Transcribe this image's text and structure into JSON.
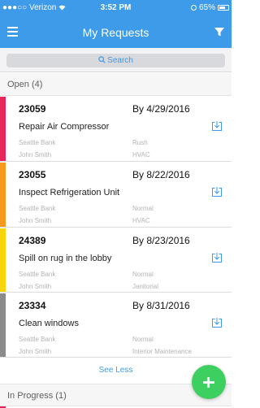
{
  "status_bar": {
    "carrier": "●●●○○ Verizon",
    "time": "3:52 PM",
    "battery": "65%"
  },
  "nav": {
    "title": "My Requests",
    "menu_icon": "hamburger-icon",
    "filter_icon": "filter-icon"
  },
  "search": {
    "placeholder": "Search",
    "icon": "search-icon"
  },
  "sections": {
    "open": "Open (4)",
    "in_progress": "In Progress (1)"
  },
  "requests": [
    {
      "id": "23059",
      "due": "By 4/29/2016",
      "title": "Repair Air Compressor",
      "location": "Seattle Bank",
      "priority": "Rush",
      "assignee": "John Smith",
      "category": "HVAC",
      "color": "#e8265a"
    },
    {
      "id": "23055",
      "due": "By 8/22/2016",
      "title": "Inspect Refrigeration Unit",
      "location": "Seattle Bank",
      "priority": "Normal",
      "assignee": "John Smith",
      "category": "HVAC",
      "color": "#f59a1c"
    },
    {
      "id": "24389",
      "due": "By 8/23/2016",
      "title": "Spill on rug in the lobby",
      "location": "Seattle Bank",
      "priority": "Normal",
      "assignee": "John Smith",
      "category": "Janitorial",
      "color": "#f7d50a"
    },
    {
      "id": "23334",
      "due": "By 8/31/2016",
      "title": "Clean windows",
      "location": "Seattle Bank",
      "priority": "Normal",
      "assignee": "John Smith",
      "category": "Interior Maintenance",
      "color": "#8b8b8b"
    }
  ],
  "see_less": "See Less",
  "fab_icon": "plus-icon",
  "colors": {
    "accent": "#3d9be9",
    "fab": "#3dcf5f"
  }
}
